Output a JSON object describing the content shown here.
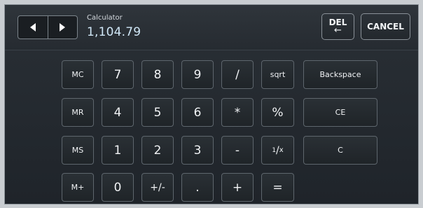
{
  "header": {
    "title": "Calculator",
    "display_value": "1,104.79",
    "del_label": "DEL",
    "del_arrow": "←",
    "cancel_label": "CANCEL"
  },
  "keys": {
    "mc": "MC",
    "mr": "MR",
    "ms": "MS",
    "mplus": "M+",
    "k7": "7",
    "k8": "8",
    "k9": "9",
    "k4": "4",
    "k5": "5",
    "k6": "6",
    "k1": "1",
    "k2": "2",
    "k3": "3",
    "k0": "0",
    "plusminus": "+/-",
    "dot": ".",
    "divide": "/",
    "multiply": "*",
    "minus": "-",
    "plus": "+",
    "sqrt": "sqrt",
    "percent": "%",
    "reciprocal_num": "1",
    "reciprocal_den": "x",
    "equals": "=",
    "backspace": "Backspace",
    "ce": "CE",
    "c": "C"
  },
  "icons": {
    "left": "triangle-left-icon",
    "right": "triangle-right-icon"
  }
}
